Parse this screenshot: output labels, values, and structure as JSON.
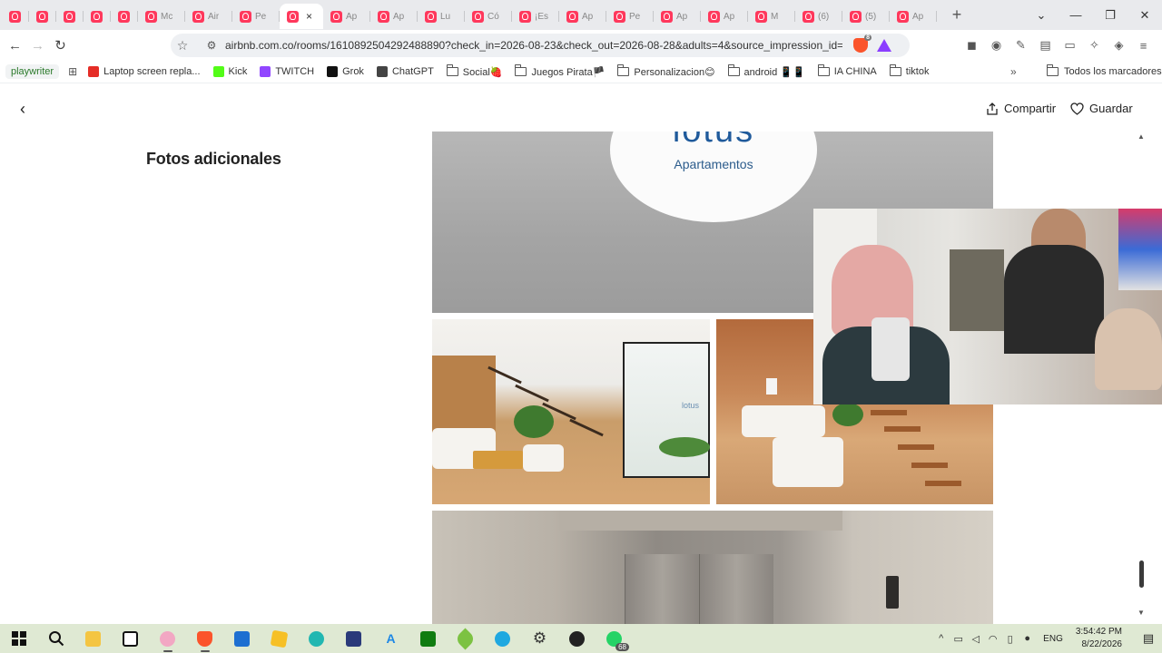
{
  "browser": {
    "tabs": [
      {
        "title": ""
      },
      {
        "title": ""
      },
      {
        "title": ""
      },
      {
        "title": ""
      },
      {
        "title": ""
      },
      {
        "title": "Mc"
      },
      {
        "title": "Air"
      },
      {
        "title": "Pe"
      }
    ],
    "active_tab": {
      "title": "",
      "close": "×"
    },
    "tabs_after": [
      {
        "title": "Ap"
      },
      {
        "title": "Ap"
      },
      {
        "title": "Lu"
      },
      {
        "title": "Có"
      },
      {
        "title": "¡Es"
      },
      {
        "title": "Ap"
      },
      {
        "title": "Pe"
      },
      {
        "title": "Ap"
      },
      {
        "title": "Ap"
      },
      {
        "title": "M"
      },
      {
        "title": "(6)"
      },
      {
        "title": "(5)"
      },
      {
        "title": "Ap"
      }
    ],
    "new_tab": "+",
    "window_controls": {
      "menu": "⌄",
      "minimize": "—",
      "restore": "❐",
      "close": "✕"
    },
    "nav": {
      "back": "←",
      "forward": "→",
      "reload": "↻"
    },
    "address": {
      "url": "airbnb.com.co/rooms/1610892504292488890?check_in=2026-08-23&check_out=2026-08-28&adults=4&source_impression_id=p...",
      "shield_count": "8"
    },
    "bookmarks": {
      "playwriter": "playwriter",
      "items": [
        {
          "label": "Laptop screen repla...",
          "color": "#e52d27"
        },
        {
          "label": "Kick",
          "color": "#53fc18"
        },
        {
          "label": "TWITCH",
          "color": "#9146ff"
        },
        {
          "label": "Grok",
          "color": "#111111"
        },
        {
          "label": "ChatGPT",
          "color": "#444444"
        }
      ],
      "folders": [
        {
          "label": "Social🍓"
        },
        {
          "label": "Juegos Pirata🏴"
        },
        {
          "label": "Personalizacion😊"
        },
        {
          "label": "android 📱📱"
        },
        {
          "label": "IA CHINA"
        },
        {
          "label": "tiktok"
        }
      ],
      "more": "»",
      "all": "Todos los marcadores"
    }
  },
  "page": {
    "back": "‹",
    "share_label": "Compartir",
    "save_label": "Guardar",
    "section_title": "Fotos adicionales",
    "sign_logo": "lotus",
    "sign_subtitle": "Apartamentos",
    "lobby_logo": "lotus"
  },
  "taskbar": {
    "whatsapp_badge": "68",
    "tray": {
      "chevron": "^",
      "language": "ENG",
      "time": "3:54:42 PM",
      "date": "8/22/2026"
    }
  },
  "colors": {
    "airbnb": "#ff385c",
    "taskbar": "#dfe9d3",
    "tabstrip": "#e9eaed"
  }
}
